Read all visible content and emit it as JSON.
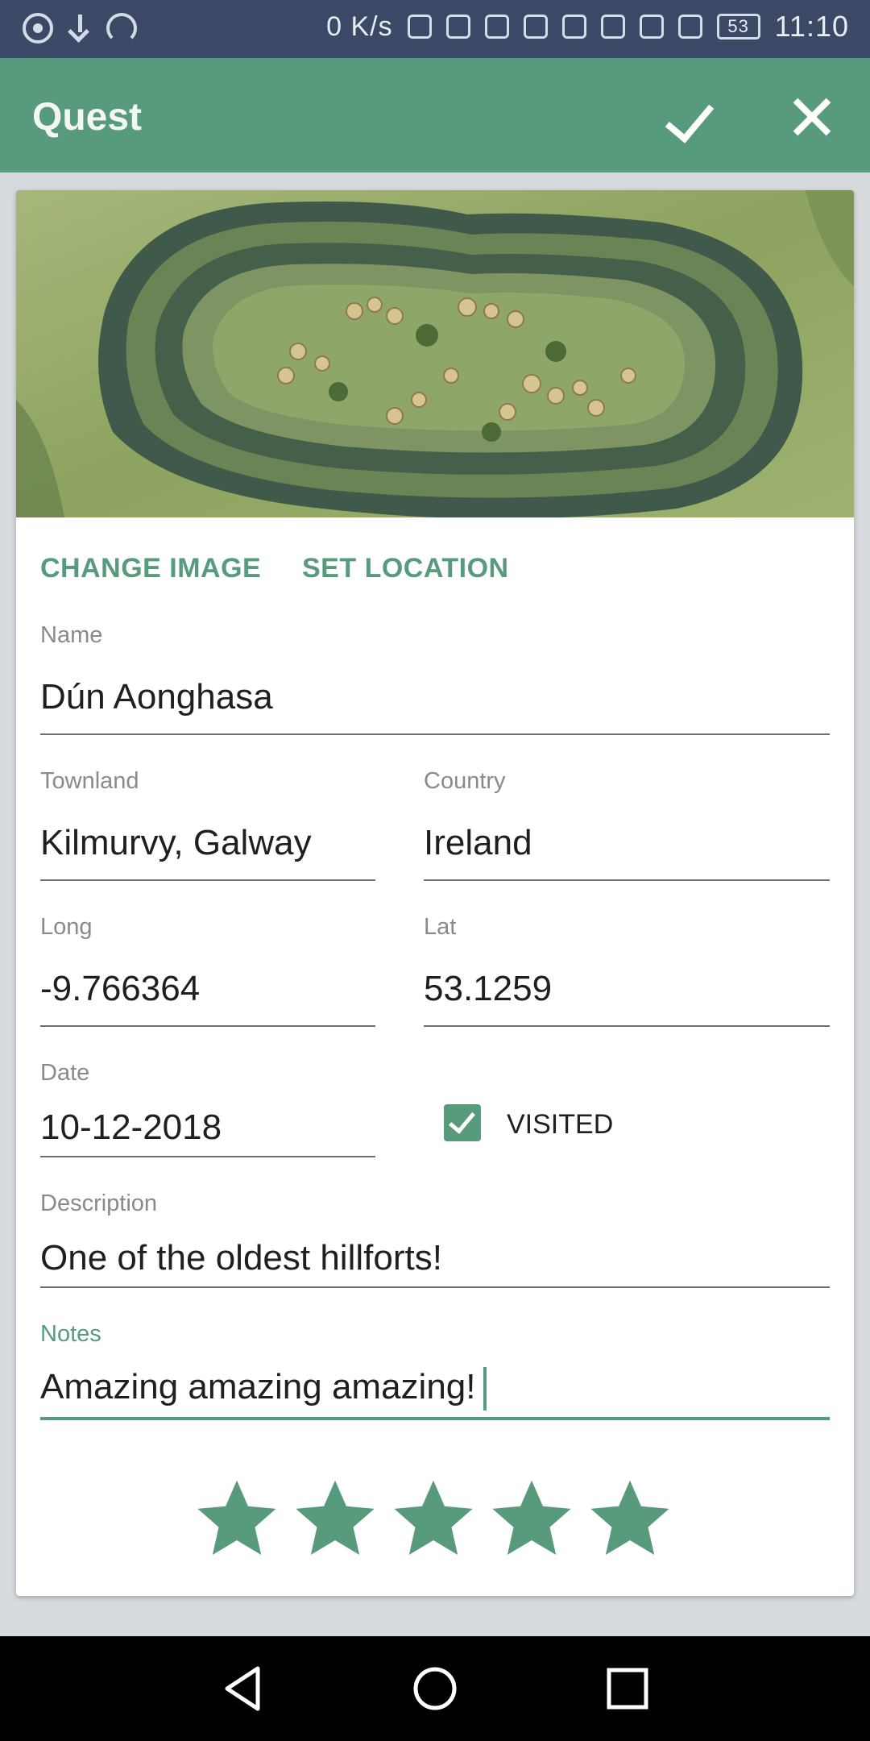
{
  "status_bar": {
    "network_speed": "0 K/s",
    "battery": "53",
    "time": "11:10"
  },
  "app_bar": {
    "title": "Quest",
    "confirm_icon": "check-icon",
    "close_icon": "close-icon"
  },
  "actions": {
    "change_image": "CHANGE IMAGE",
    "set_location": "SET LOCATION"
  },
  "form": {
    "name": {
      "label": "Name",
      "value": "Dún Aonghasa"
    },
    "townland": {
      "label": "Townland",
      "value": "Kilmurvy, Galway"
    },
    "country": {
      "label": "Country",
      "value": "Ireland"
    },
    "long": {
      "label": "Long",
      "value": "-9.766364"
    },
    "lat": {
      "label": "Lat",
      "value": "53.1259"
    },
    "date": {
      "label": "Date",
      "value": "10-12-2018"
    },
    "visited": {
      "label": "VISITED",
      "checked": true
    },
    "description": {
      "label": "Description",
      "value": "One of the oldest hillforts!"
    },
    "notes": {
      "label": "Notes",
      "value": "Amazing amazing amazing!"
    }
  },
  "rating": {
    "value": 5,
    "max": 5
  },
  "colors": {
    "accent": "#579a7c",
    "status_bar": "#3b4866",
    "nav_bar": "#000000"
  }
}
